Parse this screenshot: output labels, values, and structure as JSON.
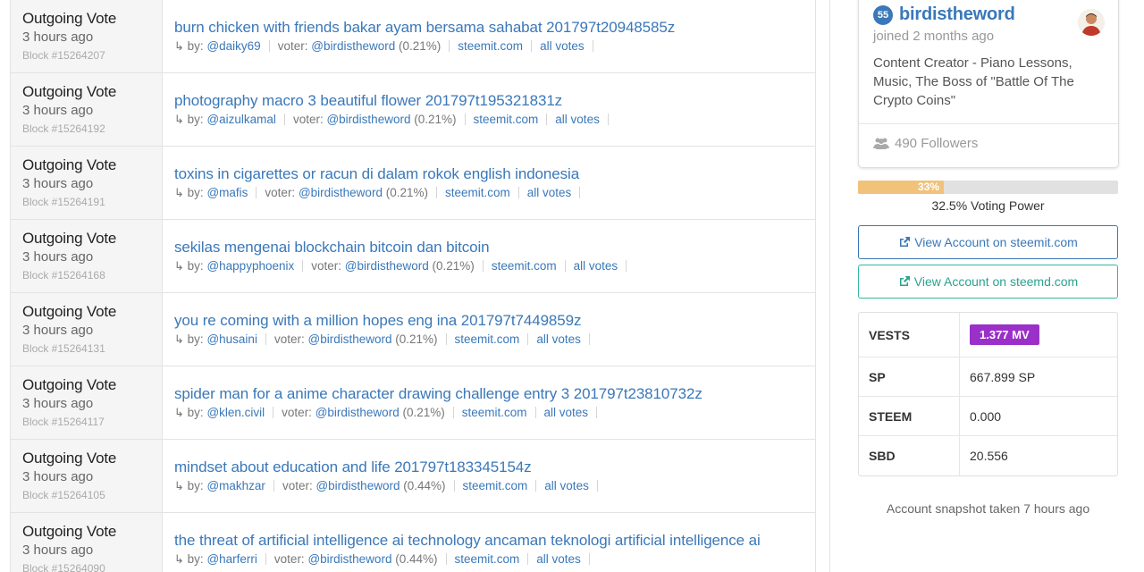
{
  "votes": [
    {
      "type": "Outgoing Vote",
      "time": "3 hours ago",
      "block": "Block #15264207",
      "title": "burn chicken with friends bakar ayam bersama sahabat 201797t20948585z",
      "by_label": "by:",
      "author": "@daiky69",
      "voter_label": "voter:",
      "voter": "@birdistheword",
      "pct": "(0.21%)",
      "link": "steemit.com",
      "all_votes": "all votes"
    },
    {
      "type": "Outgoing Vote",
      "time": "3 hours ago",
      "block": "Block #15264192",
      "title": "photography macro 3 beautiful flower 201797t195321831z",
      "by_label": "by:",
      "author": "@aizulkamal",
      "voter_label": "voter:",
      "voter": "@birdistheword",
      "pct": "(0.21%)",
      "link": "steemit.com",
      "all_votes": "all votes"
    },
    {
      "type": "Outgoing Vote",
      "time": "3 hours ago",
      "block": "Block #15264191",
      "title": "toxins in cigarettes or racun di dalam rokok english indonesia",
      "by_label": "by:",
      "author": "@mafis",
      "voter_label": "voter:",
      "voter": "@birdistheword",
      "pct": "(0.21%)",
      "link": "steemit.com",
      "all_votes": "all votes"
    },
    {
      "type": "Outgoing Vote",
      "time": "3 hours ago",
      "block": "Block #15264168",
      "title": "sekilas mengenai blockchain bitcoin dan bitcoin",
      "by_label": "by:",
      "author": "@happyphoenix",
      "voter_label": "voter:",
      "voter": "@birdistheword",
      "pct": "(0.21%)",
      "link": "steemit.com",
      "all_votes": "all votes"
    },
    {
      "type": "Outgoing Vote",
      "time": "3 hours ago",
      "block": "Block #15264131",
      "title": "you re coming with a million hopes eng ina 201797t7449859z",
      "by_label": "by:",
      "author": "@husaini",
      "voter_label": "voter:",
      "voter": "@birdistheword",
      "pct": "(0.21%)",
      "link": "steemit.com",
      "all_votes": "all votes"
    },
    {
      "type": "Outgoing Vote",
      "time": "3 hours ago",
      "block": "Block #15264117",
      "title": "spider man for a anime character drawing challenge entry 3 201797t23810732z",
      "by_label": "by:",
      "author": "@klen.civil",
      "voter_label": "voter:",
      "voter": "@birdistheword",
      "pct": "(0.21%)",
      "link": "steemit.com",
      "all_votes": "all votes"
    },
    {
      "type": "Outgoing Vote",
      "time": "3 hours ago",
      "block": "Block #15264105",
      "title": "mindset about education and life 201797t183345154z",
      "by_label": "by:",
      "author": "@makhzar",
      "voter_label": "voter:",
      "voter": "@birdistheword",
      "pct": "(0.44%)",
      "link": "steemit.com",
      "all_votes": "all votes"
    },
    {
      "type": "Outgoing Vote",
      "time": "3 hours ago",
      "block": "Block #15264090",
      "title": "the threat of artificial intelligence ai technology ancaman teknologi artificial intelligence ai",
      "by_label": "by:",
      "author": "@harferri",
      "voter_label": "voter:",
      "voter": "@birdistheword",
      "pct": "(0.44%)",
      "link": "steemit.com",
      "all_votes": "all votes"
    }
  ],
  "profile": {
    "reputation": "55",
    "username": "birdistheword",
    "joined": "joined 2 months ago",
    "bio": "Content Creator - Piano Lessons, Music, The Boss of \"Battle Of The Crypto Coins\"",
    "followers": "490 Followers",
    "avatar_icon": "user-avatar"
  },
  "voting_power": {
    "fill_percent": 33,
    "bar_label": "33%",
    "label": "32.5% Voting Power",
    "fill_color": "#f0c27a"
  },
  "buttons": {
    "steemit": "View Account on steemit.com",
    "steemd": "View Account on steemd.com"
  },
  "stats": [
    {
      "key": "VESTS",
      "value": "1.377 MV",
      "badge": true
    },
    {
      "key": "SP",
      "value": "667.899 SP",
      "badge": false
    },
    {
      "key": "STEEM",
      "value": "0.000",
      "badge": false
    },
    {
      "key": "SBD",
      "value": "20.556",
      "badge": false
    }
  ],
  "snapshot": "Account snapshot taken 7 hours ago",
  "colors": {
    "link": "#3a78b9",
    "vests_badge": "#9b30c9",
    "steemd_accent": "#35b6a1"
  }
}
